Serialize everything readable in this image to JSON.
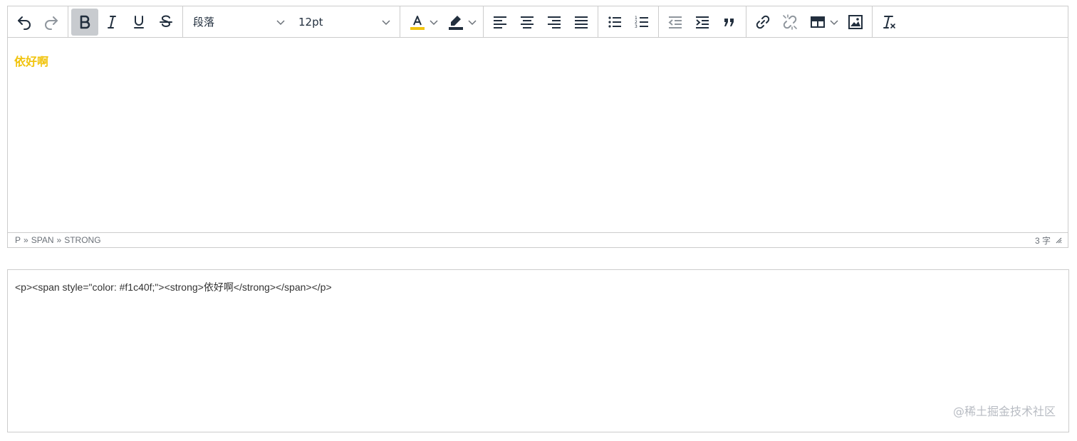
{
  "toolbar": {
    "block_format": "段落",
    "font_size": "12pt",
    "text_color": "#f1c40f",
    "highlight_color": "#222f3e"
  },
  "icons": [
    "undo-icon",
    "redo-icon",
    "bold-icon",
    "italic-icon",
    "underline-icon",
    "strikethrough-icon",
    "text-color-icon",
    "highlight-icon",
    "align-left-icon",
    "align-center-icon",
    "align-right-icon",
    "align-justify-icon",
    "bullet-list-icon",
    "numbered-list-icon",
    "outdent-icon",
    "indent-icon",
    "blockquote-icon",
    "link-icon",
    "unlink-icon",
    "table-icon",
    "image-icon",
    "clear-formatting-icon",
    "resize-handle-icon"
  ],
  "content": {
    "text": "依好啊",
    "color": "#f1c40f"
  },
  "statusbar": {
    "path": [
      "P",
      "SPAN",
      "STRONG"
    ],
    "separator": "»",
    "word_count": "3 字"
  },
  "output": {
    "html": "<p><span style=\"color: #f1c40f;\"><strong>依好啊</strong></span></p>"
  },
  "watermark": "@稀土掘金技术社区"
}
